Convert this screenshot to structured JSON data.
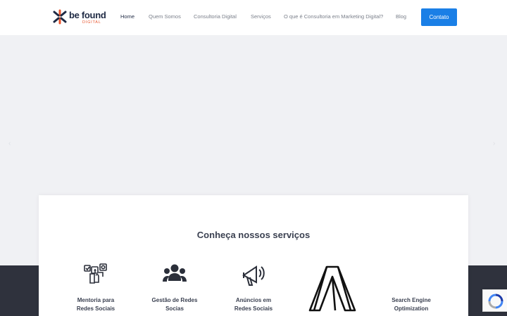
{
  "logo": {
    "name": "be found",
    "sub": "DIGITAL"
  },
  "nav": {
    "items": [
      {
        "label": "Home",
        "active": true
      },
      {
        "label": "Quem Somos",
        "active": false
      },
      {
        "label": "Consultoria Digital",
        "active": false
      },
      {
        "label": "Serviços",
        "active": false
      },
      {
        "label": "O que é Consultoria em Marketing Digital?",
        "active": false
      },
      {
        "label": "Blog",
        "active": false
      }
    ],
    "cta_label": "Contato"
  },
  "colors": {
    "accent": "#1a7fe6",
    "logo_orange": "#e8532b",
    "logo_navy": "#1f2a44",
    "dark_band": "#2f323d"
  },
  "services": {
    "title": "Conheça nossos serviços",
    "items": [
      {
        "line1": "Mentoria para",
        "line2": "Redes Sociais",
        "icon": "social-media-icon"
      },
      {
        "line1": "Gestão de Redes",
        "line2": "Socias",
        "icon": "users-icon"
      },
      {
        "line1": "Anúncios em",
        "line2": "Redes Sociais",
        "icon": "megaphone-icon"
      },
      {
        "line1": "",
        "line2": "",
        "icon": "ads-logo-icon"
      },
      {
        "line1": "Search Engine",
        "line2": "Optimization",
        "icon": "seo-icon"
      }
    ]
  }
}
